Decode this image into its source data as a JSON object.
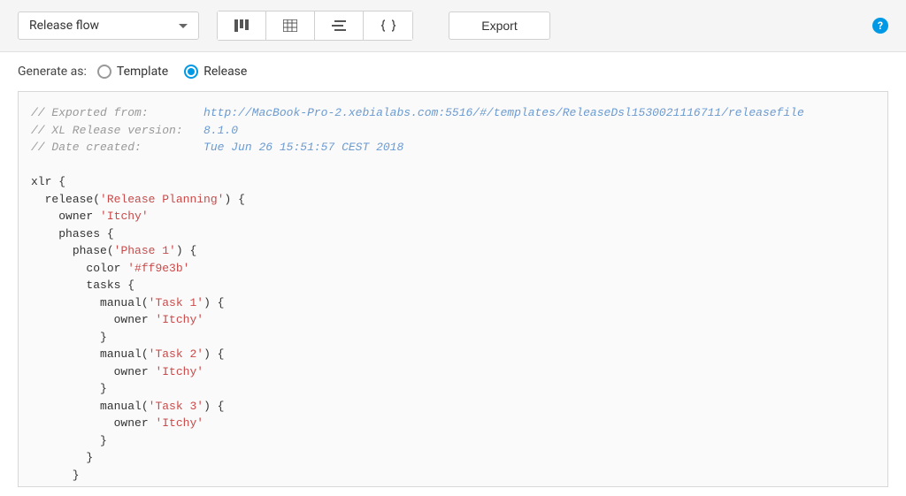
{
  "toolbar": {
    "dropdown_label": "Release flow",
    "export_label": "Export"
  },
  "generate": {
    "label": "Generate as:",
    "option_template": "Template",
    "option_release": "Release",
    "selected": "Release"
  },
  "code": {
    "comment_exported_label": "// Exported from:        ",
    "comment_exported_value": "http://MacBook-Pro-2.xebialabs.com:5516/#/templates/ReleaseDsl1530021116711/releasefile",
    "comment_version_label": "// XL Release version:   ",
    "comment_version_value": "8.1.0",
    "comment_date_label": "// Date created:         ",
    "comment_date_value": "Tue Jun 26 15:51:57 CEST 2018",
    "root_kw": "xlr",
    "release_kw": "release",
    "release_name": "'Release Planning'",
    "owner_kw": "owner",
    "owner_val": "'Itchy'",
    "phases_kw": "phases",
    "phase_kw": "phase",
    "phase_name": "'Phase 1'",
    "color_kw": "color",
    "color_val": "'#ff9e3b'",
    "tasks_kw": "tasks",
    "manual_kw": "manual",
    "task1_name": "'Task 1'",
    "task2_name": "'Task 2'",
    "task3_name": "'Task 3'"
  }
}
